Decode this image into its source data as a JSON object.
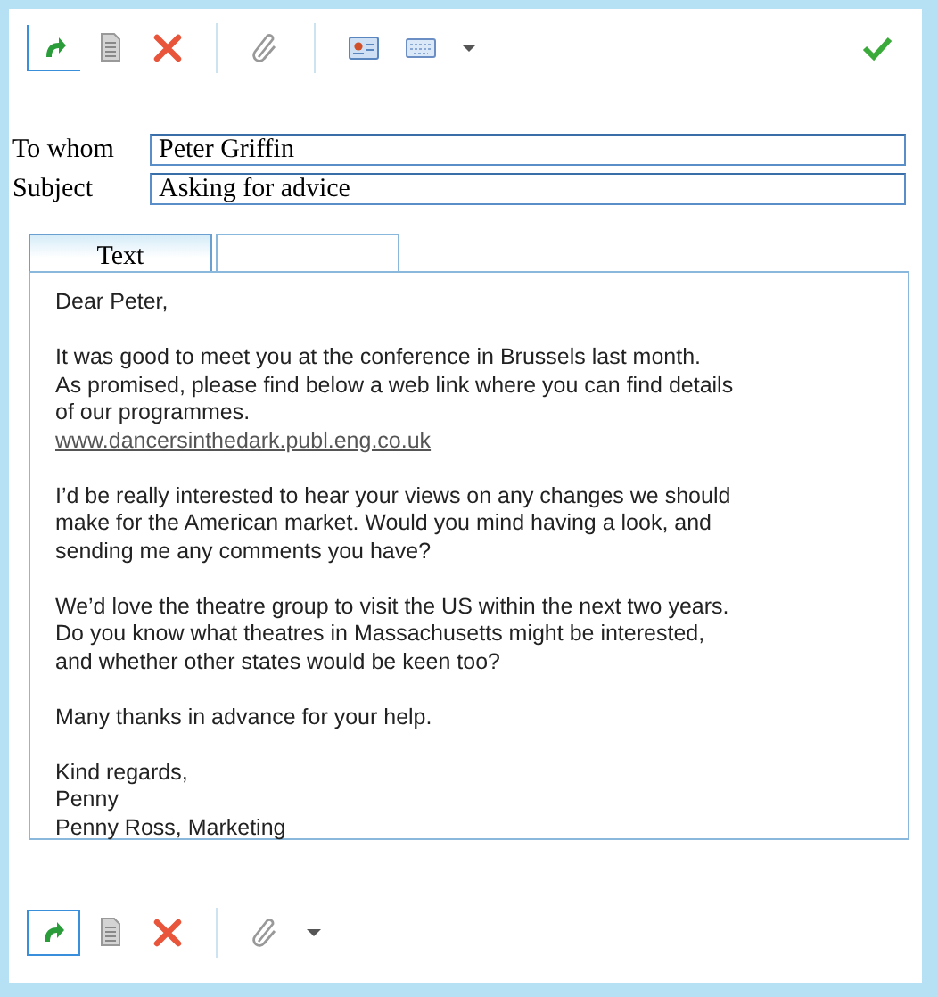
{
  "top_toolbar": {
    "items": [
      {
        "kind": "arrow",
        "focused": true
      },
      {
        "kind": "document",
        "focused": false
      },
      {
        "kind": "delete",
        "focused": false
      },
      {
        "kind": "separator"
      },
      {
        "kind": "paperclip",
        "focused": false
      },
      {
        "kind": "separator"
      },
      {
        "kind": "card",
        "focused": false
      },
      {
        "kind": "keyboard",
        "focused": false
      },
      {
        "kind": "caret",
        "focused": false
      },
      {
        "kind": "spacer"
      },
      {
        "kind": "check",
        "focused": false
      }
    ]
  },
  "fields": [
    {
      "label": "To whom",
      "value": "Peter Griffin"
    },
    {
      "label": "Subject",
      "value": "Asking for advice"
    }
  ],
  "tabs": [
    {
      "label": "Text",
      "selected": true
    },
    {
      "selected": false
    }
  ],
  "message": [
    {
      "kind": "text",
      "lines": [
        "Dear Peter,"
      ]
    },
    {
      "kind": "text",
      "lines": [
        "It was good to meet you at the conference in Brussels last month.",
        "As promised, please find below a web link where you can find details",
        "of our programmes."
      ],
      "link": "www.dancersinthedark.publ.eng.co.uk"
    },
    {
      "kind": "text",
      "lines": [
        "I’d be really interested to hear your views on any changes we should",
        "make for the American market. Would you mind having a look, and",
        "sending me any comments you have?"
      ]
    },
    {
      "kind": "text",
      "lines": [
        "We’d love the theatre group to visit the US within the next two years.",
        "Do you know what theatres in Massachusetts might be interested,",
        "and whether other states would be keen too?"
      ]
    },
    {
      "kind": "text",
      "lines": [
        "Many thanks in advance for your help."
      ]
    },
    {
      "kind": "text",
      "lines": [
        "Kind regards,",
        "Penny",
        "Penny Ross, Marketing"
      ]
    }
  ],
  "bottom_toolbar": {
    "items": [
      {
        "kind": "arrow",
        "focused": true
      },
      {
        "kind": "document",
        "focused": false
      },
      {
        "kind": "delete",
        "focused": false
      },
      {
        "kind": "separator"
      },
      {
        "kind": "paperclip",
        "focused": false
      },
      {
        "kind": "caret",
        "focused": false
      }
    ]
  }
}
